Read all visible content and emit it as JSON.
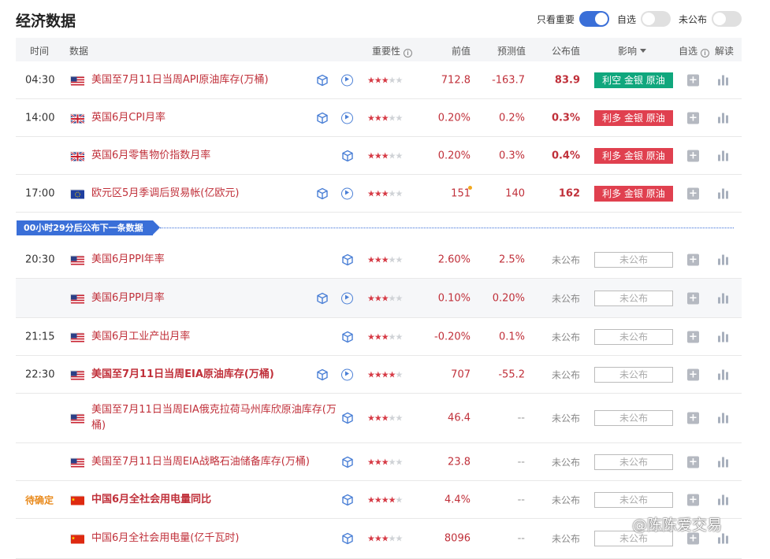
{
  "page_title": "经济数据",
  "toggles": [
    {
      "label": "只看重要",
      "on": true
    },
    {
      "label": "自选",
      "on": false
    },
    {
      "label": "未公布",
      "on": false
    }
  ],
  "columns": {
    "time": "时间",
    "data": "数据",
    "importance": "重要性",
    "previous": "前值",
    "forecast": "预测值",
    "actual": "公布值",
    "impact": "影响",
    "watch": "自选",
    "analysis": "解读"
  },
  "banner": "00小时29分后公布下一条数据",
  "watermark": "@陈陈爱交易",
  "rows": [
    {
      "time": "04:30",
      "country": "us",
      "name": "美国至7月11日当周API原油库存(万桶)",
      "bold": false,
      "stars": 3,
      "prev": "712.8",
      "forecast": "-163.7",
      "actual": "83.9",
      "impact": "利空 金银 原油",
      "impact_type": "green",
      "video": true,
      "alt": false
    },
    {
      "time": "14:00",
      "country": "gb",
      "name": "英国6月CPI月率",
      "bold": false,
      "stars": 3,
      "prev": "0.20%",
      "forecast": "0.2%",
      "actual": "0.3%",
      "impact": "利多 金银 原油",
      "impact_type": "red",
      "video": true,
      "alt": false
    },
    {
      "time": "",
      "country": "gb",
      "name": "英国6月零售物价指数月率",
      "bold": false,
      "stars": 3,
      "prev": "0.20%",
      "forecast": "0.3%",
      "actual": "0.4%",
      "impact": "利多 金银 原油",
      "impact_type": "red",
      "video": false,
      "alt": false
    },
    {
      "time": "17:00",
      "country": "eu",
      "name": "欧元区5月季调后贸易帐(亿欧元)",
      "bold": false,
      "stars": 3,
      "prev": "151",
      "forecast": "140",
      "actual": "162",
      "impact": "利多 金银 原油",
      "impact_type": "red",
      "video": true,
      "alt": false
    },
    {
      "time": "20:30",
      "country": "us",
      "name": "美国6月PPI年率",
      "bold": false,
      "stars": 3,
      "prev": "2.60%",
      "forecast": "2.5%",
      "actual": "未公布",
      "impact": "未公布",
      "impact_type": "np",
      "video": false,
      "alt": false
    },
    {
      "time": "",
      "country": "us",
      "name": "美国6月PPI月率",
      "bold": false,
      "stars": 3,
      "prev": "0.10%",
      "forecast": "0.20%",
      "actual": "未公布",
      "impact": "未公布",
      "impact_type": "np",
      "video": true,
      "alt": true
    },
    {
      "time": "21:15",
      "country": "us",
      "name": "美国6月工业产出月率",
      "bold": false,
      "stars": 3,
      "prev": "-0.20%",
      "forecast": "0.1%",
      "actual": "未公布",
      "impact": "未公布",
      "impact_type": "np",
      "video": false,
      "alt": false
    },
    {
      "time": "22:30",
      "country": "us",
      "name": "美国至7月11日当周EIA原油库存(万桶)",
      "bold": true,
      "stars": 4,
      "prev": "707",
      "forecast": "-55.2",
      "actual": "未公布",
      "impact": "未公布",
      "impact_type": "np",
      "video": true,
      "alt": false
    },
    {
      "time": "",
      "country": "us",
      "name": "美国至7月11日当周EIA俄克拉荷马州库欣原油库存(万桶)",
      "bold": false,
      "stars": 3,
      "prev": "46.4",
      "forecast": "--",
      "actual": "未公布",
      "impact": "未公布",
      "impact_type": "np",
      "video": false,
      "alt": false
    },
    {
      "time": "",
      "country": "us",
      "name": "美国至7月11日当周EIA战略石油储备库存(万桶)",
      "bold": false,
      "stars": 3,
      "prev": "23.8",
      "forecast": "--",
      "actual": "未公布",
      "impact": "未公布",
      "impact_type": "np",
      "video": false,
      "alt": false
    },
    {
      "time": "待确定",
      "country": "cn",
      "name": "中国6月全社会用电量同比",
      "bold": true,
      "stars": 4,
      "prev": "4.4%",
      "forecast": "--",
      "actual": "未公布",
      "impact": "未公布",
      "impact_type": "np",
      "video": false,
      "alt": false,
      "pending": true
    },
    {
      "time": "",
      "country": "cn",
      "name": "中国6月全社会用电量(亿千瓦时)",
      "bold": false,
      "stars": 3,
      "prev": "8096",
      "forecast": "--",
      "actual": "未公布",
      "impact": "未公布",
      "impact_type": "np",
      "video": false,
      "alt": false
    }
  ]
}
